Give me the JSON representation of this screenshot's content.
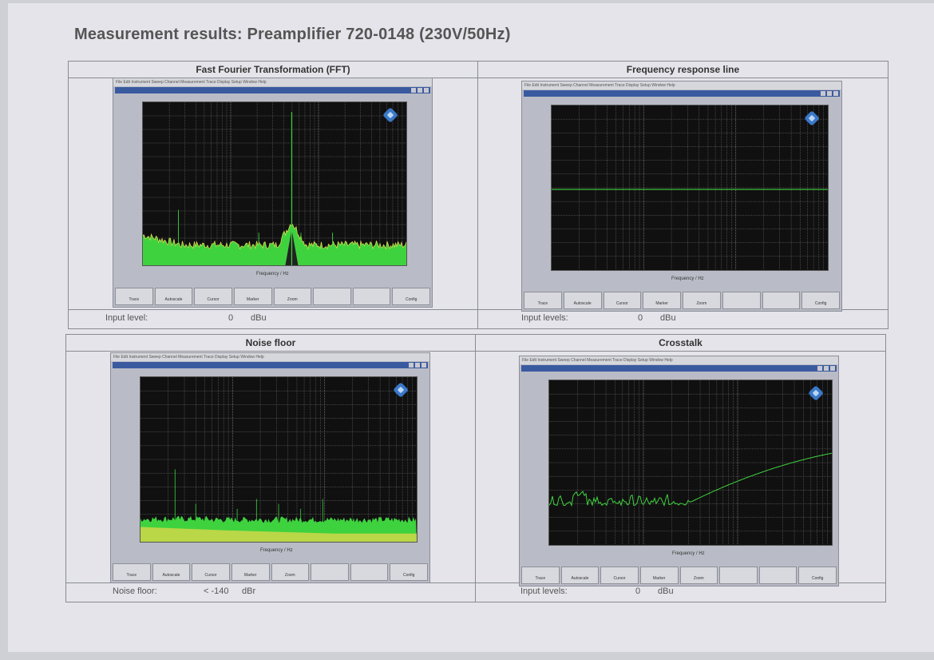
{
  "page": {
    "title": "Measurement results: Preamplifier 720-0148 (230V/50Hz)"
  },
  "panels": {
    "fft": {
      "title": "Fast Fourier Transformation (FFT)",
      "footer_label": "Input level:",
      "footer_value": "0",
      "footer_unit": "dBu",
      "xlabel": "Frequency / Hz"
    },
    "freq": {
      "title": "Frequency response line",
      "footer_label": "Input levels:",
      "footer_value": "0",
      "footer_unit": "dBu",
      "xlabel": "Frequency / Hz"
    },
    "noise": {
      "title": "Noise floor",
      "footer_label": "Noise floor:",
      "footer_value": "< -140",
      "footer_unit": "dBr",
      "xlabel": "Frequency / Hz"
    },
    "crosstalk": {
      "title": "Crosstalk",
      "footer_label": "Input levels:",
      "footer_value": "0",
      "footer_unit": "dBu",
      "xlabel": "Frequency / Hz"
    }
  },
  "analyzer": {
    "menu": "File  Edit  Instrument  Sweep  Channel  Measurement  Trace  Display  Setup  Window  Help",
    "toolbar": [
      "Trace",
      "Autoscale",
      "Cursor",
      "Marker",
      "Zoom",
      "",
      "",
      "Config"
    ]
  },
  "colors": {
    "trace_green": "#3fd23f",
    "trace_yellow": "#d8d84a",
    "grid": "#7a7a7a",
    "plot_bg": "#101010"
  }
}
